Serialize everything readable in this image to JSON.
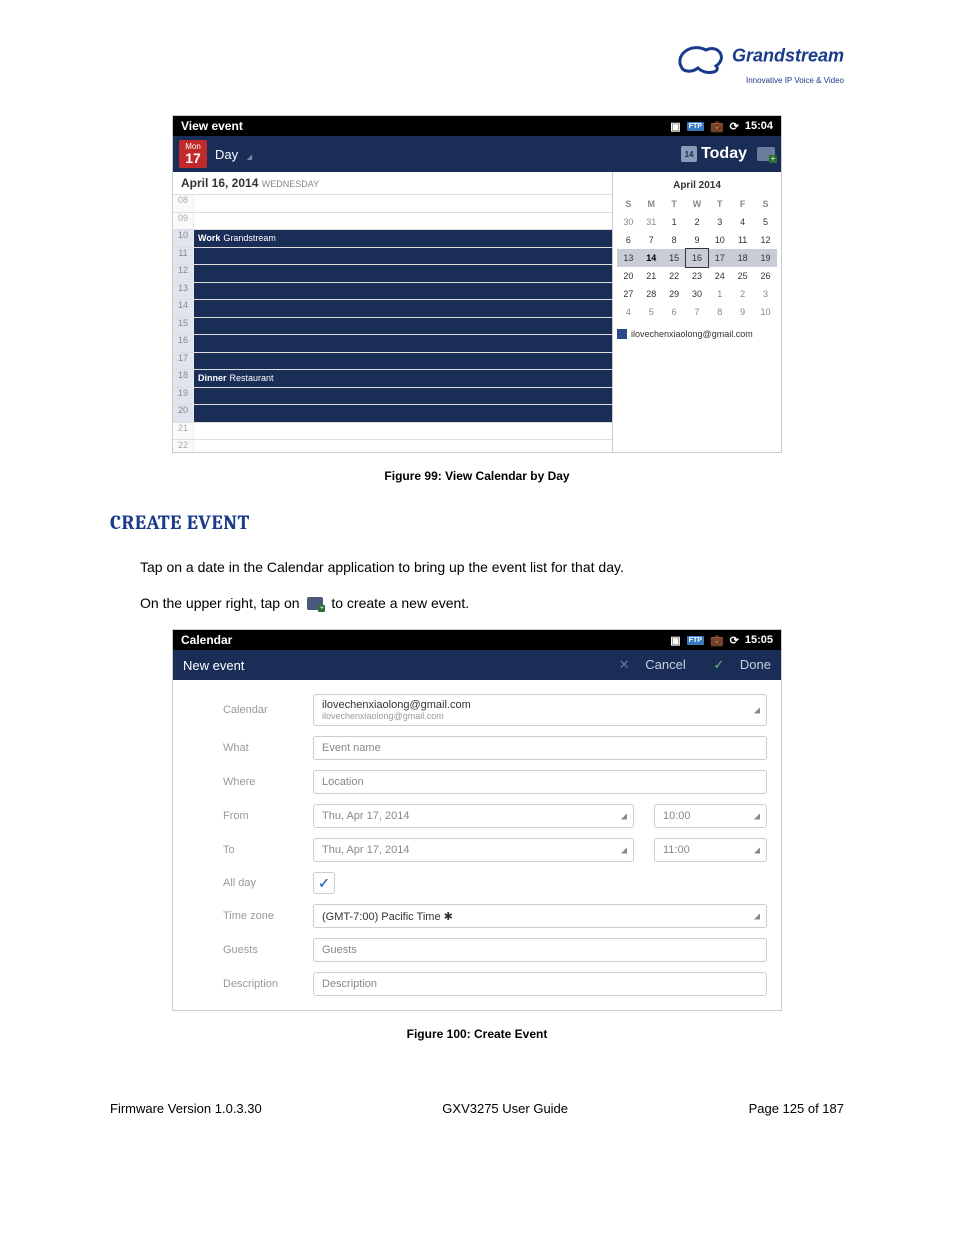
{
  "brand": {
    "name": "Grandstream",
    "tagline": "Innovative IP Voice & Video"
  },
  "fig1": {
    "caption": "Figure 99: View Calendar by Day",
    "statusbar_title": "View event",
    "statusbar_time": "15:04",
    "cal_icon_wd": "Mon",
    "cal_icon_day": "17",
    "view_label": "Day",
    "today_mini": "14",
    "today_label": "Today",
    "date_header": "April 16, 2014",
    "date_wd": "WEDNESDAY",
    "hours": [
      "08",
      "09",
      "10",
      "11",
      "12",
      "13",
      "14",
      "15",
      "16",
      "17",
      "18",
      "19",
      "20",
      "21",
      "22"
    ],
    "event10_bold": "Work",
    "event10_rest": "Grandstream",
    "event18_bold": "Dinner",
    "event18_rest": "Restaurant",
    "month_title": "April 2014",
    "wds": [
      "S",
      "M",
      "T",
      "W",
      "T",
      "F",
      "S"
    ],
    "grid": [
      [
        {
          "t": "30"
        },
        {
          "t": "31"
        },
        {
          "t": "1",
          "cm": 1
        },
        {
          "t": "2",
          "cm": 1
        },
        {
          "t": "3",
          "cm": 1
        },
        {
          "t": "4",
          "cm": 1
        },
        {
          "t": "5",
          "cm": 1
        }
      ],
      [
        {
          "t": "6",
          "cm": 1
        },
        {
          "t": "7",
          "cm": 1
        },
        {
          "t": "8",
          "cm": 1
        },
        {
          "t": "9",
          "cm": 1
        },
        {
          "t": "10",
          "cm": 1
        },
        {
          "t": "11",
          "cm": 1
        },
        {
          "t": "12",
          "cm": 1
        }
      ],
      [
        {
          "t": "13",
          "cm": 1,
          "sr": 1
        },
        {
          "t": "14",
          "cm": 1,
          "sr": 1,
          "td": 1
        },
        {
          "t": "15",
          "cm": 1,
          "sr": 1
        },
        {
          "t": "16",
          "cm": 1,
          "sr": 1,
          "sd": 1
        },
        {
          "t": "17",
          "cm": 1,
          "sr": 1
        },
        {
          "t": "18",
          "cm": 1,
          "sr": 1
        },
        {
          "t": "19",
          "cm": 1,
          "sr": 1
        }
      ],
      [
        {
          "t": "20",
          "cm": 1
        },
        {
          "t": "21",
          "cm": 1
        },
        {
          "t": "22",
          "cm": 1
        },
        {
          "t": "23",
          "cm": 1
        },
        {
          "t": "24",
          "cm": 1
        },
        {
          "t": "25",
          "cm": 1
        },
        {
          "t": "26",
          "cm": 1
        }
      ],
      [
        {
          "t": "27",
          "cm": 1
        },
        {
          "t": "28",
          "cm": 1
        },
        {
          "t": "29",
          "cm": 1
        },
        {
          "t": "30",
          "cm": 1
        },
        {
          "t": "1"
        },
        {
          "t": "2"
        },
        {
          "t": "3"
        }
      ],
      [
        {
          "t": "4"
        },
        {
          "t": "5"
        },
        {
          "t": "6"
        },
        {
          "t": "7"
        },
        {
          "t": "8"
        },
        {
          "t": "9"
        },
        {
          "t": "10"
        }
      ]
    ],
    "legend_email": "ilovechenxiaolong@gmail.com"
  },
  "section_heading": "CREATE EVENT",
  "para1": "Tap on a date in the Calendar application to bring up the event list for that day.",
  "para2_a": "On the upper right, tap on",
  "para2_b": "to create a new event.",
  "fig2": {
    "caption": "Figure 100: Create Event",
    "statusbar_title": "Calendar",
    "statusbar_time": "15:05",
    "formbar_title": "New event",
    "cancel": "Cancel",
    "done": "Done",
    "labels": {
      "calendar": "Calendar",
      "what": "What",
      "where": "Where",
      "from": "From",
      "to": "To",
      "allday": "All day",
      "tz": "Time zone",
      "guests": "Guests",
      "desc": "Description"
    },
    "cal_main": "ilovechenxiaolong@gmail.com",
    "cal_sub": "ilovechenxiaolong@gmail.com",
    "what_ph": "Event name",
    "where_ph": "Location",
    "from_date": "Thu, Apr 17, 2014",
    "from_time": "10:00",
    "to_date": "Thu, Apr 17, 2014",
    "to_time": "11:00",
    "tz_val": "(GMT-7:00) Pacific Time ✱",
    "guests_ph": "Guests",
    "desc_ph": "Description"
  },
  "footer": {
    "left": "Firmware Version 1.0.3.30",
    "center": "GXV3275 User Guide",
    "right": "Page 125 of 187"
  }
}
